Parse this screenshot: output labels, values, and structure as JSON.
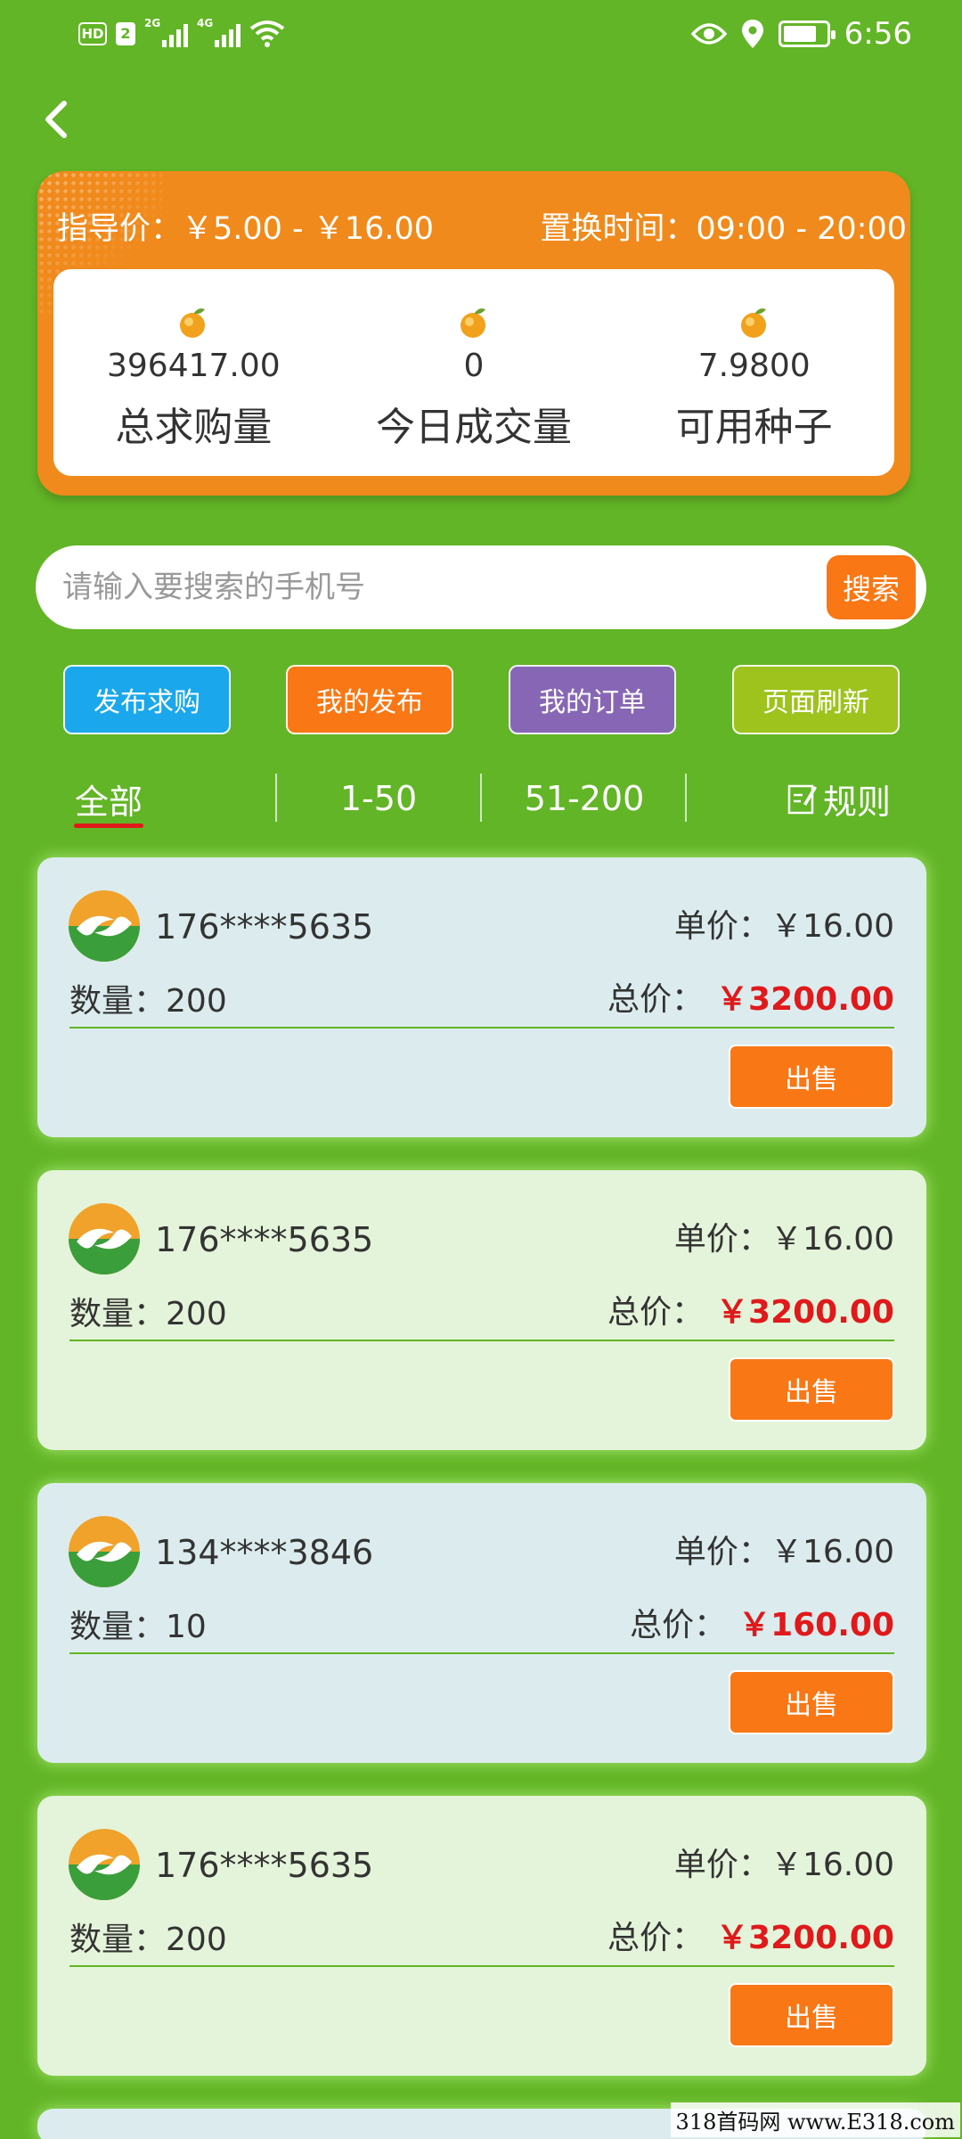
{
  "status_bar": {
    "hd": "HD",
    "sim": "2",
    "signal_1": "2G",
    "signal_2": "4G",
    "time": "6:56"
  },
  "stats": {
    "guide_price": "指导价：￥5.00 - ￥16.00",
    "swap_time": "置换时间：09:00 - 20:00",
    "items": [
      {
        "value": "396417.00",
        "label": "总求购量"
      },
      {
        "value": "0",
        "label": "今日成交量"
      },
      {
        "value": "7.9800",
        "label": "可用种子"
      }
    ]
  },
  "search": {
    "placeholder": "请输入要搜索的手机号",
    "button": "搜索"
  },
  "actions": [
    {
      "label": "发布求购",
      "color": "#1aa7ec"
    },
    {
      "label": "我的发布",
      "color": "#f97714"
    },
    {
      "label": "我的订单",
      "color": "#8767b5"
    },
    {
      "label": "页面刷新",
      "color": "#9dc31c"
    }
  ],
  "tabs": {
    "all": "全部",
    "range_1": "1-50",
    "range_2": "51-200",
    "rules": "规则"
  },
  "orders": [
    {
      "phone": "176****5635",
      "unit_price_label": "单价：",
      "unit_price": "￥16.00",
      "qty_label": "数量：",
      "qty": "200",
      "total_label": "总价：",
      "total": "￥3200.00",
      "sell": "出售"
    },
    {
      "phone": "176****5635",
      "unit_price_label": "单价：",
      "unit_price": "￥16.00",
      "qty_label": "数量：",
      "qty": "200",
      "total_label": "总价：",
      "total": "￥3200.00",
      "sell": "出售"
    },
    {
      "phone": "134****3846",
      "unit_price_label": "单价：",
      "unit_price": "￥16.00",
      "qty_label": "数量：",
      "qty": "10",
      "total_label": "总价：",
      "total": "￥160.00",
      "sell": "出售"
    },
    {
      "phone": "176****5635",
      "unit_price_label": "单价：",
      "unit_price": "￥16.00",
      "qty_label": "数量：",
      "qty": "200",
      "total_label": "总价：",
      "total": "￥3200.00",
      "sell": "出售"
    }
  ],
  "watermark": "318首码网 www.E318.com"
}
